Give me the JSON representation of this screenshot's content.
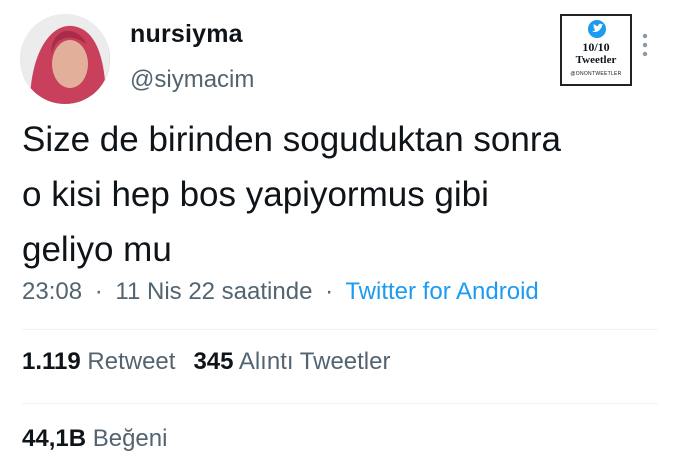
{
  "user": {
    "display_name": "nursiyma",
    "handle": "@siymacim"
  },
  "stamp": {
    "rating": "10/10",
    "label": "Tweetler",
    "small": "@ONONTWEETLER"
  },
  "tweet": {
    "text": "Size de birinden soguduktan sonra\no kisi hep bos yapiyormus gibi\ngeliyo mu",
    "time": "23:08",
    "date": "11 Nis 22 saatinde",
    "separator": "·",
    "source": "Twitter for Android"
  },
  "stats": {
    "retweets": "1.119",
    "retweets_label": "Retweet",
    "quotes": "345",
    "quotes_label": "Alıntı Tweetler",
    "likes": "44,1B",
    "likes_label": "Beğeni"
  },
  "icons": {
    "more": "more-icon",
    "stamp_bird": "twitter-bird-icon"
  },
  "colors": {
    "accent": "#1d9bf0",
    "secondary_text": "#536471",
    "primary_text": "#0f1419",
    "divider": "#eff3f4"
  }
}
